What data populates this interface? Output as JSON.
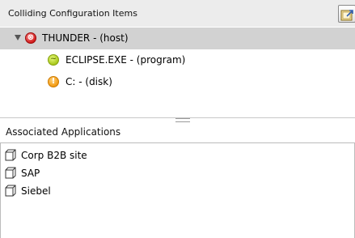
{
  "top_panel": {
    "title": "Colliding Configuration Items",
    "button_icon": "export-icon",
    "tree": [
      {
        "label": "THUNDER - (host)",
        "status_icon": "error-icon",
        "symbol": "⊗",
        "expanded": true,
        "selected": true
      },
      {
        "label": "ECLIPSE.EXE - (program)",
        "status_icon": "program-icon",
        "symbol": "~"
      },
      {
        "label": "C: - (disk)",
        "status_icon": "warning-icon",
        "symbol": "!"
      }
    ]
  },
  "bottom_panel": {
    "title": "Associated Applications",
    "items": [
      {
        "label": "Corp B2B site",
        "icon": "application-cube-icon"
      },
      {
        "label": "SAP",
        "icon": "application-cube-icon"
      },
      {
        "label": "Siebel",
        "icon": "application-cube-icon"
      }
    ]
  },
  "colors": {
    "selected_row": "#d2d2d2",
    "header_bg": "#ececec",
    "error": "#d21a1a",
    "program": "#a9c81c",
    "warning": "#f39a12"
  }
}
